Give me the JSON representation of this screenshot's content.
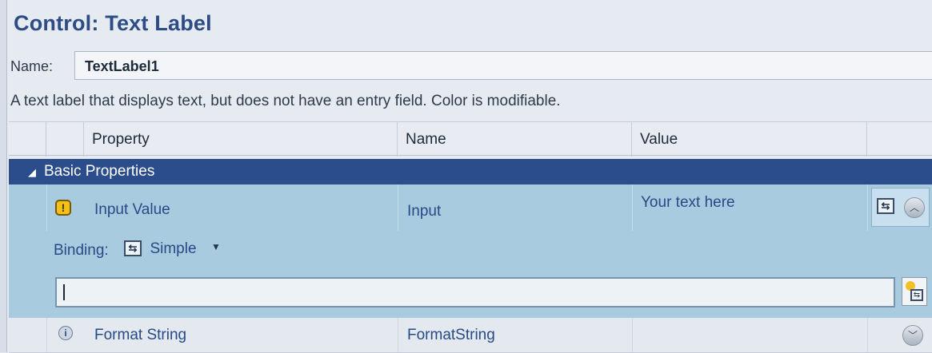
{
  "header": {
    "title": "Control: Text Label",
    "name_label": "Name:",
    "name_value": "TextLabel1",
    "description": "A text label that displays text, but does not have an entry field. Color is modifiable."
  },
  "grid": {
    "columns": [
      "Property",
      "Name",
      "Value"
    ],
    "group": {
      "label": "Basic Properties",
      "expanded": true
    },
    "rows": [
      {
        "property": "Input Value",
        "name": "Input",
        "value": "Your text here",
        "status_icon": "warning-icon",
        "selected": true,
        "binding_label": "Binding:",
        "binding_mode": "Simple",
        "binding_expression": ""
      },
      {
        "property": "Format String",
        "name": "FormatString",
        "value": "",
        "status_icon": "info-icon",
        "selected": false
      }
    ]
  },
  "colors": {
    "title": "#2d4c86",
    "group_header_bg": "#2b4d8c",
    "selected_row_bg": "#a9cbe0"
  }
}
